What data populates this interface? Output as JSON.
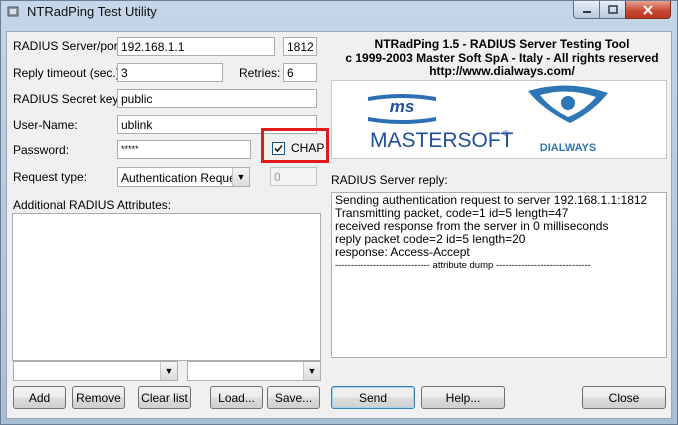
{
  "window": {
    "title": "NTRadPing Test Utility"
  },
  "labels": {
    "server_port": "RADIUS Server/port:",
    "reply_timeout": "Reply timeout (sec.):",
    "retries": "Retries:",
    "secret_key": "RADIUS Secret key:",
    "user_name": "User-Name:",
    "password": "Password:",
    "request_type": "Request type:",
    "additional_attributes": "Additional RADIUS Attributes:",
    "server_reply": "RADIUS Server reply:",
    "chap": "CHAP"
  },
  "fields": {
    "server": "192.168.1.1",
    "port": "1812",
    "reply_timeout": "3",
    "retries": "6",
    "secret_key": "public",
    "user_name": "ublink",
    "password": "*****",
    "request_type": "Authentication Request",
    "request_id": "0",
    "attr_name": "",
    "attr_value": ""
  },
  "chap_checked": true,
  "header": {
    "line1": "NTRadPing 1.5 - RADIUS Server Testing Tool",
    "line2": "c 1999-2003 Master Soft SpA - Italy - All rights reserved",
    "line3": "http://www.dialways.com/"
  },
  "logos": {
    "ms": "ms",
    "mastersoft": "MASTERSOFT",
    "registered": "®",
    "dialways": "DIALWAYS"
  },
  "reply_lines": [
    "Sending authentication request to server 192.168.1.1:1812",
    "Transmitting packet, code=1 id=5 length=47",
    "received response from the server in 0 milliseconds",
    "reply packet code=2 id=5 length=20",
    "response: Access-Accept",
    "------------------------------ attribute dump ------------------------------"
  ],
  "buttons": {
    "add": "Add",
    "remove": "Remove",
    "clear_list": "Clear list",
    "load": "Load...",
    "save": "Save...",
    "send": "Send",
    "help": "Help...",
    "close": "Close"
  },
  "colors": {
    "highlight": "#e01b1b",
    "mastersoft_blue": "#1f4e9a",
    "dialways_blue": "#2f76b6"
  }
}
